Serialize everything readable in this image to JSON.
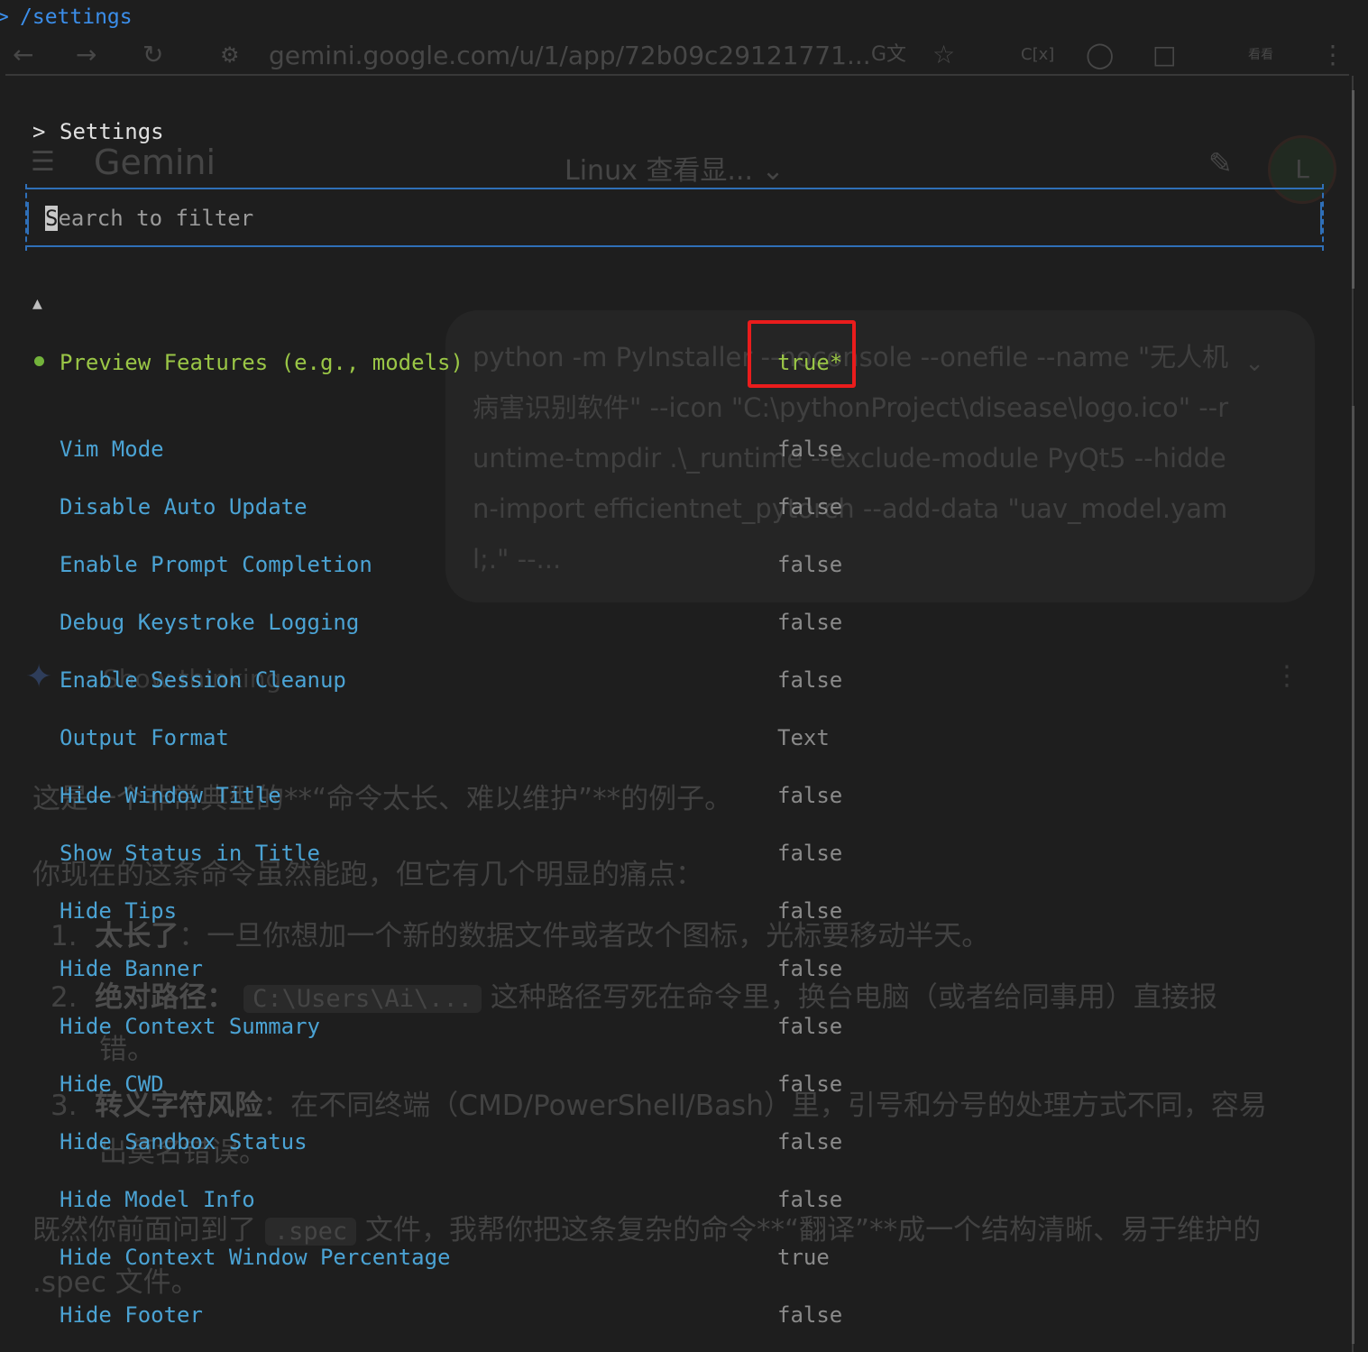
{
  "terminal": {
    "prompt_glyph": ">",
    "command": "/settings"
  },
  "browser": {
    "url": "gemini.google.com/u/1/app/72b09c29121771...",
    "icons": [
      "back-icon",
      "forward-icon",
      "reload-icon",
      "site-settings-icon",
      "translate-icon",
      "bookmark-star-icon",
      "extension-icon",
      "profile-avatar"
    ],
    "translate_label": "G文",
    "ext_label": "C[x]",
    "avatar_label": "看看"
  },
  "gemini_background": {
    "app_name": "Gemini",
    "conversation_title": "Linux 查看显...",
    "avatar_letter": "L",
    "user_prompt": "python -m PyInstaller --noconsole --onefile --name \"无人机病害识别软件\" --icon \"C:\\pythonProject\\disease\\logo.ico\" --runtime-tmpdir .\\_runtime --exclude-module PyQt5 --hidden-import efficientnet_pytorch --add-data \"uav_model.yaml;.\" --...",
    "thinking_label": "Show thinking",
    "response": {
      "intro": "这是一个非常典型的**“命令太长、难以维护”**的例子。",
      "lead": "你现在的这条命令虽然能跑，但它有几个明显的痛点：",
      "points": [
        {
          "num": "1.",
          "bold": "太长了",
          "text": "：一旦你想加一个新的数据文件或者改个图标，光标要移动半天。"
        },
        {
          "num": "2.",
          "bold": "绝对路径",
          "code": "C:\\Users\\Ai\\...",
          "text": "这种路径写死在命令里，换台电脑（或者给同事用）直接报",
          "cont": "错。"
        },
        {
          "num": "3.",
          "bold": "转义字符风险",
          "text": "：在不同终端（CMD/PowerShell/Bash）里，引号和分号的处理方式不同，容易",
          "cont": "出莫名错误。"
        }
      ],
      "outro_prefix": "既然你前面问到了",
      "outro_code": ".spec",
      "outro_text": "文件，我帮你把这条复杂的命令**“翻译”**成一个结构清晰、易于维护的",
      "outro_cont": ".spec 文件。"
    }
  },
  "settings": {
    "title": "Settings",
    "title_chevron": ">",
    "search": {
      "cursor_char": "S",
      "placeholder_rest": "earch to filter"
    },
    "scroll_up_indicator": "▲",
    "items": [
      {
        "label": "Preview Features (e.g., models)",
        "value": "true*",
        "selected": true
      },
      {
        "label": "Vim Mode",
        "value": "false"
      },
      {
        "label": "Disable Auto Update",
        "value": "false"
      },
      {
        "label": "Enable Prompt Completion",
        "value": "false"
      },
      {
        "label": "Debug Keystroke Logging",
        "value": "false"
      },
      {
        "label": "Enable Session Cleanup",
        "value": "false"
      },
      {
        "label": "Output Format",
        "value": "Text"
      },
      {
        "label": "Hide Window Title",
        "value": "false"
      },
      {
        "label": "Show Status in Title",
        "value": "false"
      },
      {
        "label": "Hide Tips",
        "value": "false"
      },
      {
        "label": "Hide Banner",
        "value": "false"
      },
      {
        "label": "Hide Context Summary",
        "value": "false"
      },
      {
        "label": "Hide CWD",
        "value": "false"
      },
      {
        "label": "Hide Sandbox Status",
        "value": "false"
      },
      {
        "label": "Hide Model Info",
        "value": "false"
      },
      {
        "label": "Hide Context Window Percentage",
        "value": "true"
      },
      {
        "label": "Hide Footer",
        "value": "false"
      }
    ]
  },
  "colors": {
    "background": "#1e1e1e",
    "label_blue": "#4ba3d4",
    "selected_green": "#9ac646",
    "value_gray": "#8a8a8a",
    "search_border": "#2f6fb8",
    "highlight_red": "#ea1c1c"
  }
}
